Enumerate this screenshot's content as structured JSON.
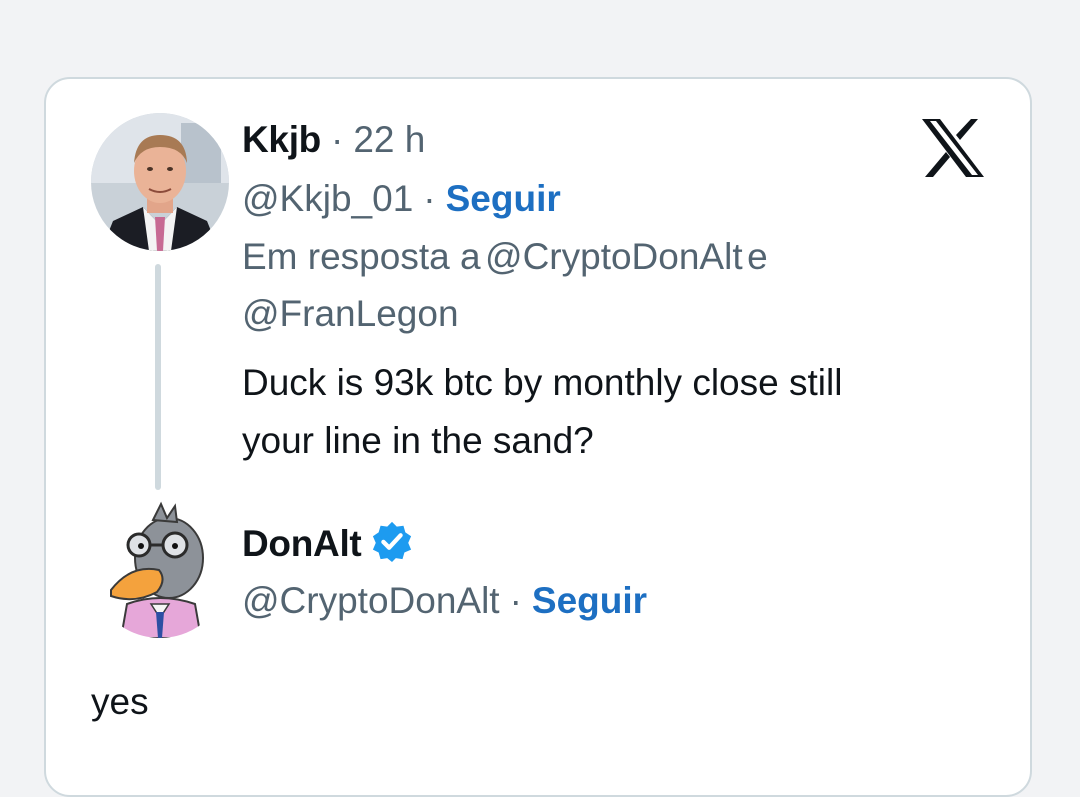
{
  "parent_tweet": {
    "display_name": "Kkjb",
    "time": "22 h",
    "handle": "@Kkjb_01",
    "follow_label": "Seguir",
    "reply_to_prefix": "Em resposta a",
    "reply_to_user_1": "@CryptoDonAlt",
    "reply_to_conj": "e",
    "reply_to_user_2": "@FranLegon",
    "text_line_1": "Duck is 93k btc by monthly close still",
    "text_line_2": "your line in the sand?"
  },
  "reply_tweet": {
    "display_name": "DonAlt",
    "handle": "@CryptoDonAlt",
    "follow_label": "Seguir",
    "verified": true,
    "text": "yes"
  },
  "separator": "·",
  "icons": {
    "platform": "x-logo-icon",
    "verified": "verified-badge-icon"
  },
  "colors": {
    "link": "#1d6fc2",
    "muted": "#536471",
    "text": "#0f1419",
    "verified": "#1d9bf0",
    "border": "#cfd9de"
  }
}
